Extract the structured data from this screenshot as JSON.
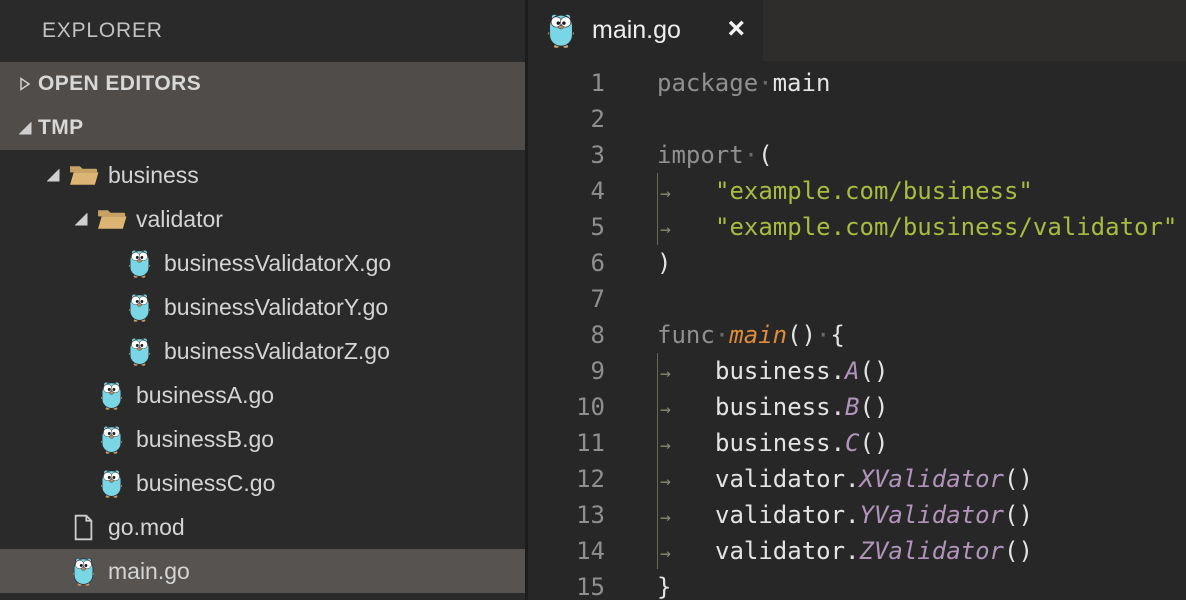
{
  "colors": {
    "editor_bg": "#272727",
    "sidebar_bg": "#2a2a2a",
    "section_header_bg": "#4f4c49",
    "selected_row_bg": "#565351",
    "tab_strip_bg": "#2e2d2c",
    "gopher_cyan": "#7ad5e4",
    "folder_tan": "#dcb575",
    "keyword_gray": "#909090",
    "string_green": "#a8bc41",
    "func_orange": "#dc8c3a",
    "func_purple": "#b294bb",
    "line_number_gray": "#8f8f8f"
  },
  "sidebar": {
    "title": "EXPLORER",
    "sections": [
      {
        "label": "OPEN EDITORS",
        "expanded": false
      },
      {
        "label": "TMP",
        "expanded": true
      }
    ],
    "tree": [
      {
        "label": "business",
        "icon": "folder-open",
        "level": 0,
        "twistie": true,
        "selected": false
      },
      {
        "label": "validator",
        "icon": "folder-open",
        "level": 1,
        "twistie": true,
        "selected": false
      },
      {
        "label": "businessValidatorX.go",
        "icon": "go-gopher",
        "level": 2,
        "twistie": false,
        "selected": false
      },
      {
        "label": "businessValidatorY.go",
        "icon": "go-gopher",
        "level": 2,
        "twistie": false,
        "selected": false
      },
      {
        "label": "businessValidatorZ.go",
        "icon": "go-gopher",
        "level": 2,
        "twistie": false,
        "selected": false
      },
      {
        "label": "businessA.go",
        "icon": "go-gopher",
        "level": 1,
        "twistie": false,
        "selected": false
      },
      {
        "label": "businessB.go",
        "icon": "go-gopher",
        "level": 1,
        "twistie": false,
        "selected": false
      },
      {
        "label": "businessC.go",
        "icon": "go-gopher",
        "level": 1,
        "twistie": false,
        "selected": false
      },
      {
        "label": "go.mod",
        "icon": "file",
        "level": 0,
        "twistie": false,
        "selected": false
      },
      {
        "label": "main.go",
        "icon": "go-gopher",
        "level": 0,
        "twistie": false,
        "selected": true
      }
    ]
  },
  "editor": {
    "tab": {
      "label": "main.go",
      "icon": "go-gopher",
      "close": "×"
    },
    "lines": [
      {
        "num": 1,
        "guide": false,
        "segments": [
          {
            "cls": "kw",
            "t": "package"
          },
          {
            "cls": "ws",
            "t": "·"
          },
          {
            "cls": "plain",
            "t": "main"
          }
        ]
      },
      {
        "num": 2,
        "guide": false,
        "segments": []
      },
      {
        "num": 3,
        "guide": false,
        "segments": [
          {
            "cls": "kw",
            "t": "import"
          },
          {
            "cls": "ws",
            "t": "·"
          },
          {
            "cls": "plain",
            "t": "("
          }
        ]
      },
      {
        "num": 4,
        "guide": true,
        "segments": [
          {
            "cls": "tabws",
            "t": "→"
          },
          {
            "cls": "str",
            "t": "\"example.com/business\""
          }
        ]
      },
      {
        "num": 5,
        "guide": true,
        "segments": [
          {
            "cls": "tabws",
            "t": "→"
          },
          {
            "cls": "str",
            "t": "\"example.com/business/validator\""
          }
        ]
      },
      {
        "num": 6,
        "guide": false,
        "segments": [
          {
            "cls": "plain",
            "t": ")"
          }
        ]
      },
      {
        "num": 7,
        "guide": false,
        "segments": []
      },
      {
        "num": 8,
        "guide": false,
        "segments": [
          {
            "cls": "kw",
            "t": "func"
          },
          {
            "cls": "ws",
            "t": "·"
          },
          {
            "cls": "orange",
            "t": "main"
          },
          {
            "cls": "plain",
            "t": "()"
          },
          {
            "cls": "ws",
            "t": "·"
          },
          {
            "cls": "plain",
            "t": "{"
          }
        ]
      },
      {
        "num": 9,
        "guide": true,
        "segments": [
          {
            "cls": "tabws",
            "t": "→"
          },
          {
            "cls": "plain",
            "t": "business."
          },
          {
            "cls": "purple",
            "t": "A"
          },
          {
            "cls": "plain",
            "t": "()"
          }
        ]
      },
      {
        "num": 10,
        "guide": true,
        "segments": [
          {
            "cls": "tabws",
            "t": "→"
          },
          {
            "cls": "plain",
            "t": "business."
          },
          {
            "cls": "purple",
            "t": "B"
          },
          {
            "cls": "plain",
            "t": "()"
          }
        ]
      },
      {
        "num": 11,
        "guide": true,
        "segments": [
          {
            "cls": "tabws",
            "t": "→"
          },
          {
            "cls": "plain",
            "t": "business."
          },
          {
            "cls": "purple",
            "t": "C"
          },
          {
            "cls": "plain",
            "t": "()"
          }
        ]
      },
      {
        "num": 12,
        "guide": true,
        "segments": [
          {
            "cls": "tabws",
            "t": "→"
          },
          {
            "cls": "plain",
            "t": "validator."
          },
          {
            "cls": "purple",
            "t": "XValidator"
          },
          {
            "cls": "plain",
            "t": "()"
          }
        ]
      },
      {
        "num": 13,
        "guide": true,
        "segments": [
          {
            "cls": "tabws",
            "t": "→"
          },
          {
            "cls": "plain",
            "t": "validator."
          },
          {
            "cls": "purple",
            "t": "YValidator"
          },
          {
            "cls": "plain",
            "t": "()"
          }
        ]
      },
      {
        "num": 14,
        "guide": true,
        "segments": [
          {
            "cls": "tabws",
            "t": "→"
          },
          {
            "cls": "plain",
            "t": "validator."
          },
          {
            "cls": "purple",
            "t": "ZValidator"
          },
          {
            "cls": "plain",
            "t": "()"
          }
        ]
      },
      {
        "num": 15,
        "guide": false,
        "segments": [
          {
            "cls": "plain",
            "t": "}"
          }
        ]
      }
    ]
  }
}
